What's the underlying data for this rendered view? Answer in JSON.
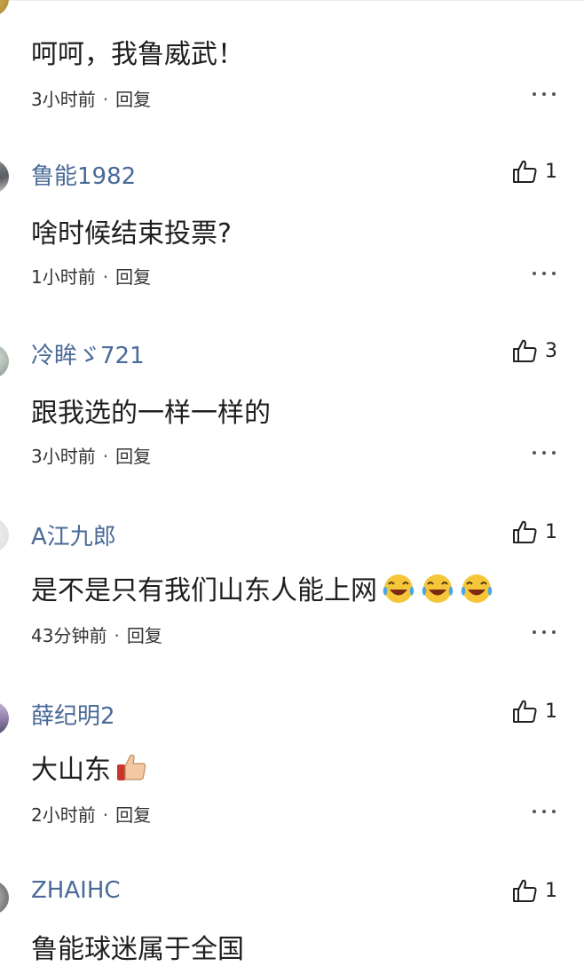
{
  "comments": [
    {
      "username": "",
      "likes": "",
      "text": "呵呵，我鲁威武！",
      "time": "3小时前",
      "reply": "回复",
      "emojis": []
    },
    {
      "username": "鲁能1982",
      "likes": "1",
      "text": "啥时候结束投票?",
      "time": "1小时前",
      "reply": "回复",
      "emojis": []
    },
    {
      "username": "冷眸ゞ721",
      "likes": "3",
      "text": "跟我选的一样一样的",
      "time": "3小时前",
      "reply": "回复",
      "emojis": []
    },
    {
      "username": "A江九郎",
      "likes": "1",
      "text": "是不是只有我们山东人能上网",
      "time": "43分钟前",
      "reply": "回复",
      "emojis": [
        "crying-laughing-emoji",
        "crying-laughing-emoji",
        "crying-laughing-emoji"
      ]
    },
    {
      "username": "薛纪明2",
      "likes": "1",
      "text": "大山东",
      "time": "2小时前",
      "reply": "回复",
      "emojis": [
        "thumbs-up-emoji"
      ]
    },
    {
      "username": "ZHAIHC",
      "likes": "1",
      "text": "鲁能球迷属于全国",
      "time": "",
      "reply": "",
      "emojis": []
    }
  ],
  "icons": {
    "like": "thumbs-up-outline-icon",
    "more": "more-dots-icon"
  },
  "colors": {
    "username": "#4a6a98",
    "text": "#1e1e1e",
    "meta": "#333333",
    "background": "#ffffff"
  }
}
